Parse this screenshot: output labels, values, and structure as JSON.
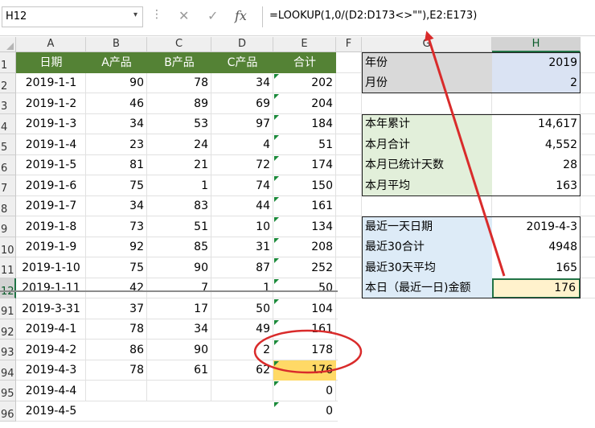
{
  "formula_bar": {
    "name_box": "H12",
    "name_box_arrow": "▾",
    "dots": "⋮",
    "cancel_icon": "✕",
    "enter_icon": "✓",
    "fx_label": "fx",
    "formula": "=LOOKUP(1,0/(D2:D173<>\"\"),E2:E173)"
  },
  "columns": [
    "A",
    "B",
    "C",
    "D",
    "E",
    "F",
    "G",
    "H"
  ],
  "rows": [
    "1",
    "2",
    "3",
    "4",
    "5",
    "6",
    "7",
    "8",
    "9",
    "10",
    "11",
    "12",
    "91",
    "92",
    "93",
    "94",
    "95",
    "96"
  ],
  "table": {
    "headers": [
      "日期",
      "A产品",
      "B产品",
      "C产品",
      "合计"
    ],
    "rows": [
      {
        "date": "2019-1-1",
        "a": "90",
        "b": "78",
        "c": "34",
        "total": "202"
      },
      {
        "date": "2019-1-2",
        "a": "46",
        "b": "89",
        "c": "69",
        "total": "204"
      },
      {
        "date": "2019-1-3",
        "a": "34",
        "b": "53",
        "c": "97",
        "total": "184"
      },
      {
        "date": "2019-1-4",
        "a": "23",
        "b": "24",
        "c": "4",
        "total": "51"
      },
      {
        "date": "2019-1-5",
        "a": "81",
        "b": "21",
        "c": "72",
        "total": "174"
      },
      {
        "date": "2019-1-6",
        "a": "75",
        "b": "1",
        "c": "74",
        "total": "150"
      },
      {
        "date": "2019-1-7",
        "a": "34",
        "b": "83",
        "c": "44",
        "total": "161"
      },
      {
        "date": "2019-1-8",
        "a": "73",
        "b": "51",
        "c": "10",
        "total": "134"
      },
      {
        "date": "2019-1-9",
        "a": "92",
        "b": "85",
        "c": "31",
        "total": "208"
      },
      {
        "date": "2019-1-10",
        "a": "75",
        "b": "90",
        "c": "87",
        "total": "252"
      },
      {
        "date": "2019-1-11",
        "a": "42",
        "b": "7",
        "c": "1",
        "total": "50"
      },
      {
        "date": "2019-3-31",
        "a": "37",
        "b": "17",
        "c": "50",
        "total": "104"
      },
      {
        "date": "2019-4-1",
        "a": "78",
        "b": "34",
        "c": "49",
        "total": "161"
      },
      {
        "date": "2019-4-2",
        "a": "86",
        "b": "90",
        "c": "2",
        "total": "178"
      },
      {
        "date": "2019-4-3",
        "a": "78",
        "b": "61",
        "c": "62",
        "total": "176"
      },
      {
        "date": "2019-4-4",
        "a": "",
        "b": "",
        "c": "",
        "total": "0"
      },
      {
        "date": "2019-4-5",
        "a": "",
        "b": "",
        "c": "",
        "total": "0"
      }
    ]
  },
  "summary": {
    "year_label": "年份",
    "year_value": "2019",
    "month_label": "月份",
    "month_value": "2",
    "ytd_label": "本年累计",
    "ytd_value": "14,617",
    "month_total_label": "本月合计",
    "month_total_value": "4,552",
    "days_label": "本月已统计天数",
    "days_value": "28",
    "month_avg_label": "本月平均",
    "month_avg_value": "163",
    "last_date_label": "最近一天日期",
    "last_date_value": "2019-4-3",
    "last30_total_label": "最近30合计",
    "last30_total_value": "4948",
    "last30_avg_label": "最近30天平均",
    "last30_avg_value": "165",
    "today_label": "本日（最近一日)金额",
    "today_value": "176"
  },
  "colors": {
    "header_green": "#548235",
    "label_green": "#e2efda",
    "blue_fill": "#dae3f3",
    "light_blue": "#ddebf7",
    "yellow": "#ffd966",
    "light_yellow": "#fff2cc",
    "annotation_red": "#d92b2b"
  }
}
